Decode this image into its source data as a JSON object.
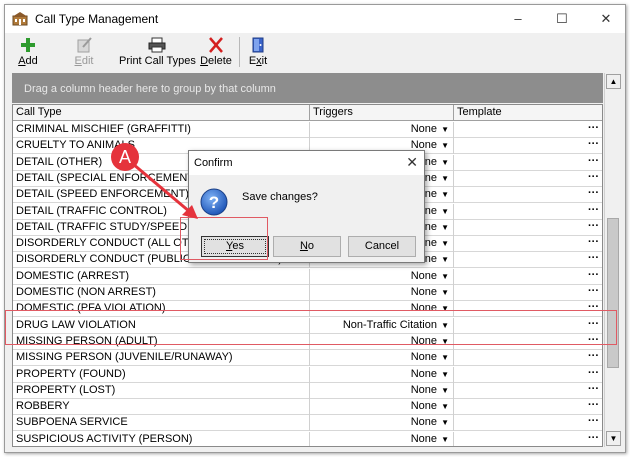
{
  "window": {
    "title": "Call Type Management",
    "controls": {
      "minimize": "–",
      "maximize": "☐",
      "close": "✕"
    }
  },
  "toolbar": {
    "add": "Add",
    "edit": "Edit",
    "print": "Print Call Types",
    "delete": "Delete",
    "exit": "Exit"
  },
  "grid": {
    "group_hint": "Drag a column header here to group by that column",
    "columns": [
      "Call Type",
      "Triggers",
      "Template"
    ],
    "rows": [
      {
        "call_type": "CRIMINAL MISCHIEF (GRAFFITTI)",
        "trigger": "None"
      },
      {
        "call_type": "CRUELTY TO ANIMALS",
        "trigger": "None"
      },
      {
        "call_type": "DETAIL (OTHER)",
        "trigger": "None"
      },
      {
        "call_type": "DETAIL (SPECIAL ENFORCEMENT)",
        "trigger": "None"
      },
      {
        "call_type": "DETAIL (SPEED ENFORCEMENT)",
        "trigger": "None"
      },
      {
        "call_type": "DETAIL (TRAFFIC CONTROL)",
        "trigger": "None"
      },
      {
        "call_type": "DETAIL (TRAFFIC STUDY/SPEED TRAILER)",
        "trigger": "None"
      },
      {
        "call_type": "DISORDERLY CONDUCT (ALL OTHERS)",
        "trigger": "None"
      },
      {
        "call_type": "DISORDERLY CONDUCT (PUBLIC DRUNKENNESS)",
        "trigger": "None"
      },
      {
        "call_type": "DOMESTIC (ARREST)",
        "trigger": "None"
      },
      {
        "call_type": "DOMESTIC (NON ARREST)",
        "trigger": "None"
      },
      {
        "call_type": "DOMESTIC (PFA VIOLATION)",
        "trigger": "None"
      },
      {
        "call_type": "DRUG LAW VIOLATION",
        "trigger": "Non-Traffic Citation"
      },
      {
        "call_type": "MISSING PERSON (ADULT)",
        "trigger": "None"
      },
      {
        "call_type": "MISSING PERSON (JUVENILE/RUNAWAY)",
        "trigger": "None"
      },
      {
        "call_type": "PROPERTY (FOUND)",
        "trigger": "None"
      },
      {
        "call_type": "PROPERTY (LOST)",
        "trigger": "None"
      },
      {
        "call_type": "ROBBERY",
        "trigger": "None"
      },
      {
        "call_type": "SUBPOENA SERVICE",
        "trigger": "None"
      },
      {
        "call_type": "SUSPICIOUS ACTIVITY (PERSON)",
        "trigger": "None"
      }
    ],
    "template_button": "···"
  },
  "dialog": {
    "title": "Confirm",
    "message": "Save changes?",
    "yes": "Yes",
    "no": "No",
    "cancel": "Cancel",
    "close": "✕"
  },
  "callout": {
    "label": "A",
    "color": "#e5333c"
  },
  "colors": {
    "highlight": "#e05a63",
    "group_panel": "#8d8d8d"
  }
}
